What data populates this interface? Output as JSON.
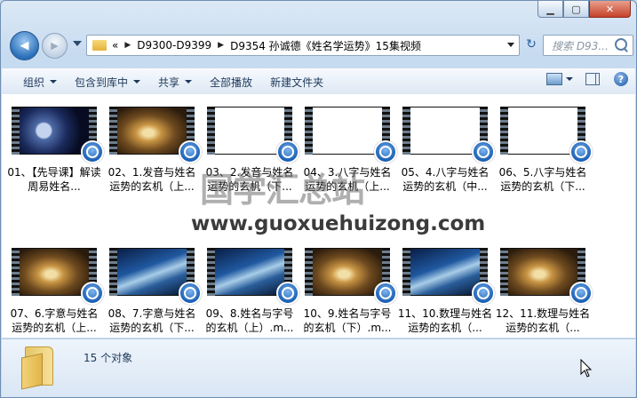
{
  "window": {
    "caption": {
      "minimize": "▁",
      "maximize": "▢",
      "close": "✕"
    }
  },
  "nav": {
    "back_icon": "◀",
    "forward_icon": "▶",
    "crumb_overflow": "«",
    "breadcrumbs": [
      "D9300-D9399",
      "D9354 孙诚德《姓名学运势》15集视频"
    ],
    "refresh_icon": "↻",
    "search_placeholder": "搜索 D93..."
  },
  "toolbar": {
    "organize": "组织",
    "include_library": "包含到库中",
    "share": "共享",
    "play_all": "全部播放",
    "new_folder": "新建文件夹",
    "help": "?"
  },
  "files": [
    {
      "label": "01、【先导课】解读周易姓名...",
      "thumb": "galaxy"
    },
    {
      "label": "02、1.发音与姓名运势的玄机（上...",
      "thumb": "gold"
    },
    {
      "label": "03、2.发音与姓名运势的玄机（下...",
      "thumb": "white"
    },
    {
      "label": "04、3.八字与姓名运势的玄机（上...",
      "thumb": "white"
    },
    {
      "label": "05、4.八字与姓名运势的玄机（中...",
      "thumb": "white"
    },
    {
      "label": "06、5.八字与姓名运势的玄机（下...",
      "thumb": "white"
    },
    {
      "label": "07、6.字意与姓名运势的玄机（上...",
      "thumb": "gold"
    },
    {
      "label": "08、7.字意与姓名运势的玄机（下...",
      "thumb": "blue"
    },
    {
      "label": "09、8.姓名与字号的玄机（上）.m...",
      "thumb": "blue"
    },
    {
      "label": "10、9.姓名与字号的玄机（下）.m...",
      "thumb": "gold"
    },
    {
      "label": "11、10.数理与姓名运势的玄机（...",
      "thumb": "blue"
    },
    {
      "label": "12、11.数理与姓名运势的玄机（...",
      "thumb": "gold"
    }
  ],
  "watermark": {
    "chinese": "国学汇总站",
    "url": "www.guoxuehuizong.com"
  },
  "status": {
    "count": "15 个对象"
  }
}
